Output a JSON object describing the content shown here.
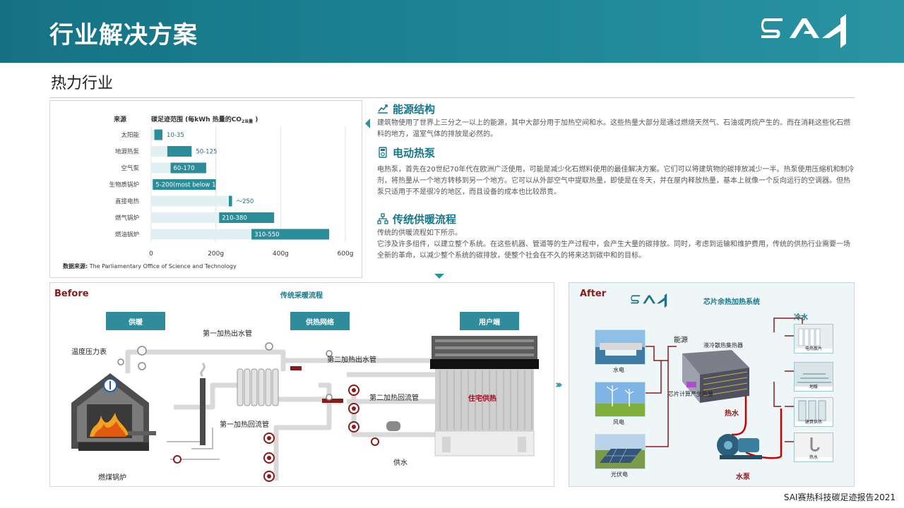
{
  "header": {
    "title": "行业解决方案",
    "logo_text": "SAI"
  },
  "subtitle": "热力行业",
  "chart_data": {
    "type": "bar",
    "title": "",
    "col_source": "来源",
    "col_range_prefix": "碳足迹范围 (每kWh 热量的CO",
    "col_range_sub": "2当量",
    "col_range_suffix": " )",
    "xlim": [
      0,
      600
    ],
    "xticks": [
      "0",
      "200g",
      "400g",
      "600g"
    ],
    "xtick_values": [
      0,
      200,
      400,
      600
    ],
    "categories": [
      "太阳能",
      "地源热泵",
      "空气泵",
      "生物质锅炉",
      "直接电热",
      "燃气锅炉",
      "燃油锅炉"
    ],
    "ranges": [
      [
        10,
        35
      ],
      [
        50,
        125
      ],
      [
        60,
        170
      ],
      [
        5,
        200
      ],
      [
        240,
        250
      ],
      [
        210,
        380
      ],
      [
        310,
        550
      ]
    ],
    "range_labels": [
      "10-35",
      "50-125",
      "60-170",
      "5-200(most below 100)",
      "～250",
      "210-380",
      "310-550"
    ],
    "source_label": "数据来源:",
    "source_text": "The Parliamentary Office of Science and Technology"
  },
  "sections": [
    {
      "icon": "chart-line-icon",
      "title": "能源结构",
      "body": "建筑物使用了世界上三分之一以上的能源，其中大部分用于加热空间和水。这些热量大部分是通过燃烧天然气、石油或丙烷产生的。而在消耗这些化石燃料的地方，温室气体的排放是必然的。"
    },
    {
      "icon": "heat-pump-icon",
      "title": "电动热泵",
      "body": "电热泵，首先在20世纪70年代在欧洲广泛使用，可能是减少化石燃料使用的最佳解决方案。它们可以将建筑物的碳排放减少一半。热泵使用压缩机和制冷剂，将热量从一个地方转移到另一个地方。它可以从外部空气中提取热量，即使是在冬天，并在屋内释放热量，基本上就像一个反向运行的空调器。但热泵只适用于不是很冷的地区，而且设备的成本也比较昂贵。"
    },
    {
      "icon": "flow-tree-icon",
      "title": "传统供暖流程",
      "body": "传统的供暖流程如下所示。\n它涉及许多组件，以建立整个系统。在这些机器、管道等的生产过程中，会产生大量的碳排放。同时，考虑到运输和维护费用，传统的供热行业需要一场全新的革命，以减少整个系统的碳排放，使整个社会在不久的将来达到碳中和的目标。"
    }
  ],
  "before": {
    "label": "Before",
    "title": "传统采暖流程",
    "stages": [
      "供暖",
      "供热网络",
      "用户端"
    ],
    "labels": {
      "pipe1_out": "第一加热出水管",
      "pipe2_out": "第二加热出水管",
      "gauge": "温度压力表",
      "pipe2_back": "第二加热回流管",
      "pipe1_back": "第一加热回流管",
      "residential": "住宅供热",
      "supply": "供水",
      "boiler": "燃煤锅炉"
    }
  },
  "after": {
    "label": "After",
    "logo_text": "SAI",
    "title": "芯片余热加热系统",
    "sources": [
      "水电",
      "风电",
      "光伏电"
    ],
    "labels": {
      "energy": "能源",
      "collector": "液冷散热集热器",
      "chip_heat": "芯片计算产生热量",
      "cold_water": "冷水",
      "hot_water": "热水",
      "pump": "水泵"
    },
    "uses": [
      "电热散片",
      "地暖",
      "建筑供热",
      "热水"
    ]
  },
  "footer": "SAI赛热科技碳足迹报告2021"
}
